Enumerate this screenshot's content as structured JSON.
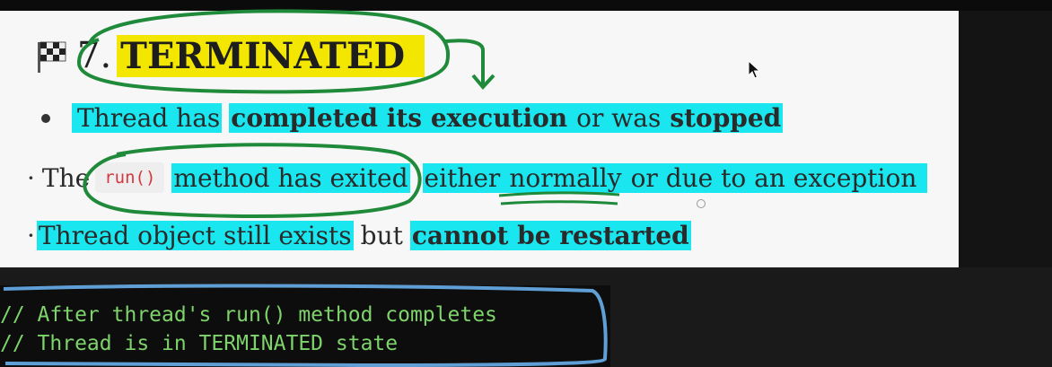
{
  "slide": {
    "heading": {
      "icon": "checkered-flag-icon",
      "number": "7.",
      "title": "TERMINATED"
    },
    "bullet1": {
      "part1": "Thread has",
      "part2": "completed its execution",
      "part3": "or was",
      "part4": "stopped"
    },
    "bullet2": {
      "bullet": "·",
      "the": "The",
      "code": "run()",
      "part1": "method has exited",
      "part2": "either",
      "part3": "normally",
      "part4": "or due to an exception"
    },
    "bullet3": {
      "bullet": "·",
      "part1": "Thread object still exists",
      "part2": "but",
      "part3": "cannot be restarted"
    }
  },
  "code": {
    "line1": "// After thread's run() method completes",
    "line2": "// Thread is in TERMINATED state"
  },
  "colors": {
    "highlight_cyan": "#19e6ef",
    "highlight_yellow": "#f3e600",
    "annotation_green": "#1f8a3a",
    "annotation_blue": "#5f9fd6",
    "code_green": "#7ed36b",
    "code_red": "#d4373d"
  }
}
